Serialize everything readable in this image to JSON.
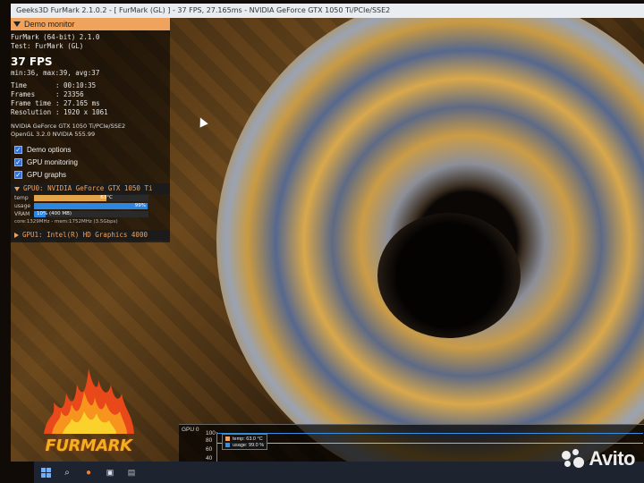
{
  "window": {
    "title": "Geeks3D FurMark 2.1.0.2 - [ FurMark (GL) ] - 37 FPS, 27.165ms - NVIDIA GeForce GTX 1050 Ti/PCIe/SSE2"
  },
  "monitor": {
    "header": "Demo monitor",
    "app_line": "FurMark (64-bit) 2.1.0",
    "test_line": "Test: FurMark (GL)",
    "fps": "37 FPS",
    "fps_stats": "min:36, max:39, avg:37",
    "stats": [
      {
        "key": "Time",
        "value": ": 00:10:35"
      },
      {
        "key": "Frames",
        "value": ": 23356"
      },
      {
        "key": "Frame time",
        "value": ": 27.165 ms"
      },
      {
        "key": "Resolution",
        "value": ": 1920 x 1061"
      }
    ],
    "gpu_renderer": "NVIDIA GeForce GTX 1050 Ti/PCIe/SSE2",
    "opengl_version": "OpenGL 3.2.0 NVIDIA 555.99",
    "options": [
      {
        "label": "Demo options",
        "checked": true
      },
      {
        "label": "GPU monitoring",
        "checked": true
      },
      {
        "label": "GPU graphs",
        "checked": true
      }
    ],
    "gpu0": {
      "header": "GPU0: NVIDIA GeForce GTX 1050 Ti",
      "temp_label": "temp",
      "temp_value": "63°C",
      "temp_fraction": 0.63,
      "usage_label": "usage",
      "usage_value": "99%",
      "usage_fraction": 0.99,
      "vram_label": "VRAM",
      "vram_value": "10% (400 MB)",
      "vram_fraction": 0.1,
      "clocks": "core:1329MHz - mem:1752MHz (3.5Gbps)"
    },
    "gpu1": {
      "header": "GPU1: Intel(R) HD Graphics 4000"
    }
  },
  "logo": {
    "text": "FURMARK"
  },
  "graph": {
    "title": "GPU 0",
    "y_ticks": [
      "100",
      "80",
      "60",
      "40"
    ],
    "legend": [
      {
        "label": "temp: 63.0 °C",
        "color": "#f0a35c"
      },
      {
        "label": "usage: 99.0 %",
        "color": "#3a8fe0"
      }
    ]
  },
  "watermark": {
    "text": "Avito"
  },
  "colors": {
    "accent_orange": "#f0a35c",
    "usage_blue": "#2e86de",
    "vram_blue": "#2e86de"
  }
}
